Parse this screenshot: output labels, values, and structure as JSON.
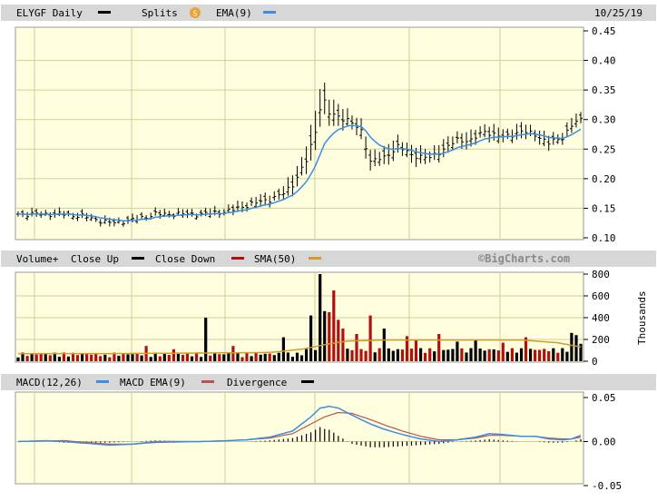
{
  "header": {
    "symbol_label": "ELYGF Daily",
    "splits_label": "Splits",
    "splits_badge": "S",
    "ema_label": "EMA(9)",
    "date": "10/25/19"
  },
  "volume_header": {
    "volume_label": "Volume+",
    "close_up_label": "Close Up",
    "close_down_label": "Close Down",
    "sma_label": "SMA(50)",
    "brand": "©BigCharts.com",
    "unit_label": "Thousands"
  },
  "macd_header": {
    "macd_label": "MACD(12,26)",
    "macd_ema_label": "MACD EMA(9)",
    "divergence_label": "Divergence"
  },
  "colors": {
    "panel_bg": "#ffffe0",
    "header_bg": "#d7d7d7",
    "grid": "#cfcf9a",
    "price_bar": "#000000",
    "ema": "#3a8ee6",
    "close_up": "#000000",
    "close_down": "#b01010",
    "sma": "#d49a2a",
    "macd": "#3a8ee6",
    "macd_ema": "#c0504d",
    "divergence": "#000000",
    "splits_badge": "#e8a33a"
  },
  "chart_data": [
    {
      "type": "ohlc",
      "panel": "price",
      "ylim": [
        0.1,
        0.45
      ],
      "yticks": [
        "0.45",
        "0.40",
        "0.35",
        "0.30",
        "0.25",
        "0.20",
        "0.15",
        "0.10"
      ],
      "ytick_values": [
        0.45,
        0.4,
        0.35,
        0.3,
        0.25,
        0.2,
        0.15,
        0.1
      ],
      "grid": true,
      "bars": 124,
      "close_anchors": [
        [
          0,
          0.14
        ],
        [
          10,
          0.14
        ],
        [
          15,
          0.135
        ],
        [
          20,
          0.125
        ],
        [
          25,
          0.13
        ],
        [
          30,
          0.14
        ],
        [
          40,
          0.14
        ],
        [
          46,
          0.145
        ],
        [
          50,
          0.155
        ],
        [
          55,
          0.165
        ],
        [
          58,
          0.175
        ],
        [
          60,
          0.19
        ],
        [
          63,
          0.23
        ],
        [
          65,
          0.28
        ],
        [
          66,
          0.32
        ],
        [
          67,
          0.33
        ],
        [
          68,
          0.31
        ],
        [
          72,
          0.3
        ],
        [
          75,
          0.28
        ],
        [
          77,
          0.23
        ],
        [
          80,
          0.235
        ],
        [
          83,
          0.255
        ],
        [
          86,
          0.24
        ],
        [
          90,
          0.235
        ],
        [
          93,
          0.25
        ],
        [
          96,
          0.265
        ],
        [
          99,
          0.265
        ],
        [
          102,
          0.28
        ],
        [
          106,
          0.27
        ],
        [
          110,
          0.28
        ],
        [
          113,
          0.275
        ],
        [
          116,
          0.26
        ],
        [
          119,
          0.27
        ],
        [
          121,
          0.29
        ],
        [
          123,
          0.3
        ]
      ],
      "range_anchors": [
        [
          0,
          0.012
        ],
        [
          40,
          0.012
        ],
        [
          58,
          0.02
        ],
        [
          64,
          0.05
        ],
        [
          67,
          0.06
        ],
        [
          70,
          0.03
        ],
        [
          77,
          0.03
        ],
        [
          90,
          0.025
        ],
        [
          123,
          0.02
        ]
      ]
    },
    {
      "type": "bar",
      "panel": "volume",
      "unit": "Thousands",
      "ylim": [
        0,
        800
      ],
      "yticks": [
        "800",
        "600",
        "400",
        "200",
        "0"
      ],
      "ytick_values": [
        800,
        600,
        400,
        200,
        0
      ],
      "grid": true,
      "spikes": [
        [
          19,
          60
        ],
        [
          28,
          140
        ],
        [
          34,
          110
        ],
        [
          41,
          400
        ],
        [
          47,
          140
        ],
        [
          58,
          220
        ],
        [
          64,
          420
        ],
        [
          66,
          800
        ],
        [
          67,
          460
        ],
        [
          68,
          450
        ],
        [
          69,
          650
        ],
        [
          70,
          380
        ],
        [
          71,
          300
        ],
        [
          74,
          250
        ],
        [
          77,
          420
        ],
        [
          80,
          300
        ],
        [
          85,
          230
        ],
        [
          87,
          200
        ],
        [
          92,
          250
        ],
        [
          96,
          180
        ],
        [
          100,
          200
        ],
        [
          106,
          170
        ],
        [
          111,
          220
        ],
        [
          121,
          260
        ],
        [
          122,
          240
        ],
        [
          123,
          160
        ]
      ],
      "sma": [
        [
          0,
          70
        ],
        [
          20,
          70
        ],
        [
          40,
          75
        ],
        [
          55,
          80
        ],
        [
          62,
          110
        ],
        [
          68,
          160
        ],
        [
          72,
          185
        ],
        [
          80,
          195
        ],
        [
          90,
          195
        ],
        [
          110,
          195
        ],
        [
          118,
          170
        ],
        [
          123,
          130
        ]
      ]
    },
    {
      "type": "macd",
      "panel": "macd",
      "ylim": [
        -0.05,
        0.05
      ],
      "yticks": [
        "0.05",
        "0.00",
        "-0.05"
      ],
      "ytick_values": [
        0.05,
        0.0,
        -0.05
      ],
      "grid": true,
      "macd_line": [
        [
          0,
          0.0
        ],
        [
          6,
          0.001
        ],
        [
          10,
          0.0
        ],
        [
          15,
          -0.002
        ],
        [
          20,
          -0.004
        ],
        [
          25,
          -0.003
        ],
        [
          30,
          0.0
        ],
        [
          40,
          0.0
        ],
        [
          46,
          0.001
        ],
        [
          50,
          0.002
        ],
        [
          55,
          0.005
        ],
        [
          60,
          0.012
        ],
        [
          64,
          0.028
        ],
        [
          66,
          0.038
        ],
        [
          68,
          0.04
        ],
        [
          70,
          0.038
        ],
        [
          73,
          0.03
        ],
        [
          77,
          0.02
        ],
        [
          80,
          0.014
        ],
        [
          84,
          0.008
        ],
        [
          88,
          0.003
        ],
        [
          92,
          0.0
        ],
        [
          96,
          0.002
        ],
        [
          100,
          0.005
        ],
        [
          103,
          0.009
        ],
        [
          106,
          0.008
        ],
        [
          110,
          0.006
        ],
        [
          113,
          0.006
        ],
        [
          116,
          0.003
        ],
        [
          119,
          0.002
        ],
        [
          121,
          0.003
        ],
        [
          123,
          0.007
        ]
      ],
      "signal_line": [
        [
          0,
          0.0
        ],
        [
          10,
          0.001
        ],
        [
          15,
          -0.001
        ],
        [
          20,
          -0.003
        ],
        [
          25,
          -0.003
        ],
        [
          30,
          -0.001
        ],
        [
          40,
          0.0
        ],
        [
          46,
          0.001
        ],
        [
          50,
          0.002
        ],
        [
          55,
          0.004
        ],
        [
          60,
          0.009
        ],
        [
          64,
          0.02
        ],
        [
          67,
          0.028
        ],
        [
          70,
          0.033
        ],
        [
          73,
          0.032
        ],
        [
          77,
          0.025
        ],
        [
          80,
          0.019
        ],
        [
          84,
          0.012
        ],
        [
          88,
          0.006
        ],
        [
          92,
          0.002
        ],
        [
          96,
          0.002
        ],
        [
          100,
          0.004
        ],
        [
          103,
          0.007
        ],
        [
          106,
          0.007
        ],
        [
          110,
          0.006
        ],
        [
          113,
          0.006
        ],
        [
          116,
          0.004
        ],
        [
          119,
          0.003
        ],
        [
          121,
          0.003
        ],
        [
          123,
          0.005
        ]
      ]
    }
  ]
}
